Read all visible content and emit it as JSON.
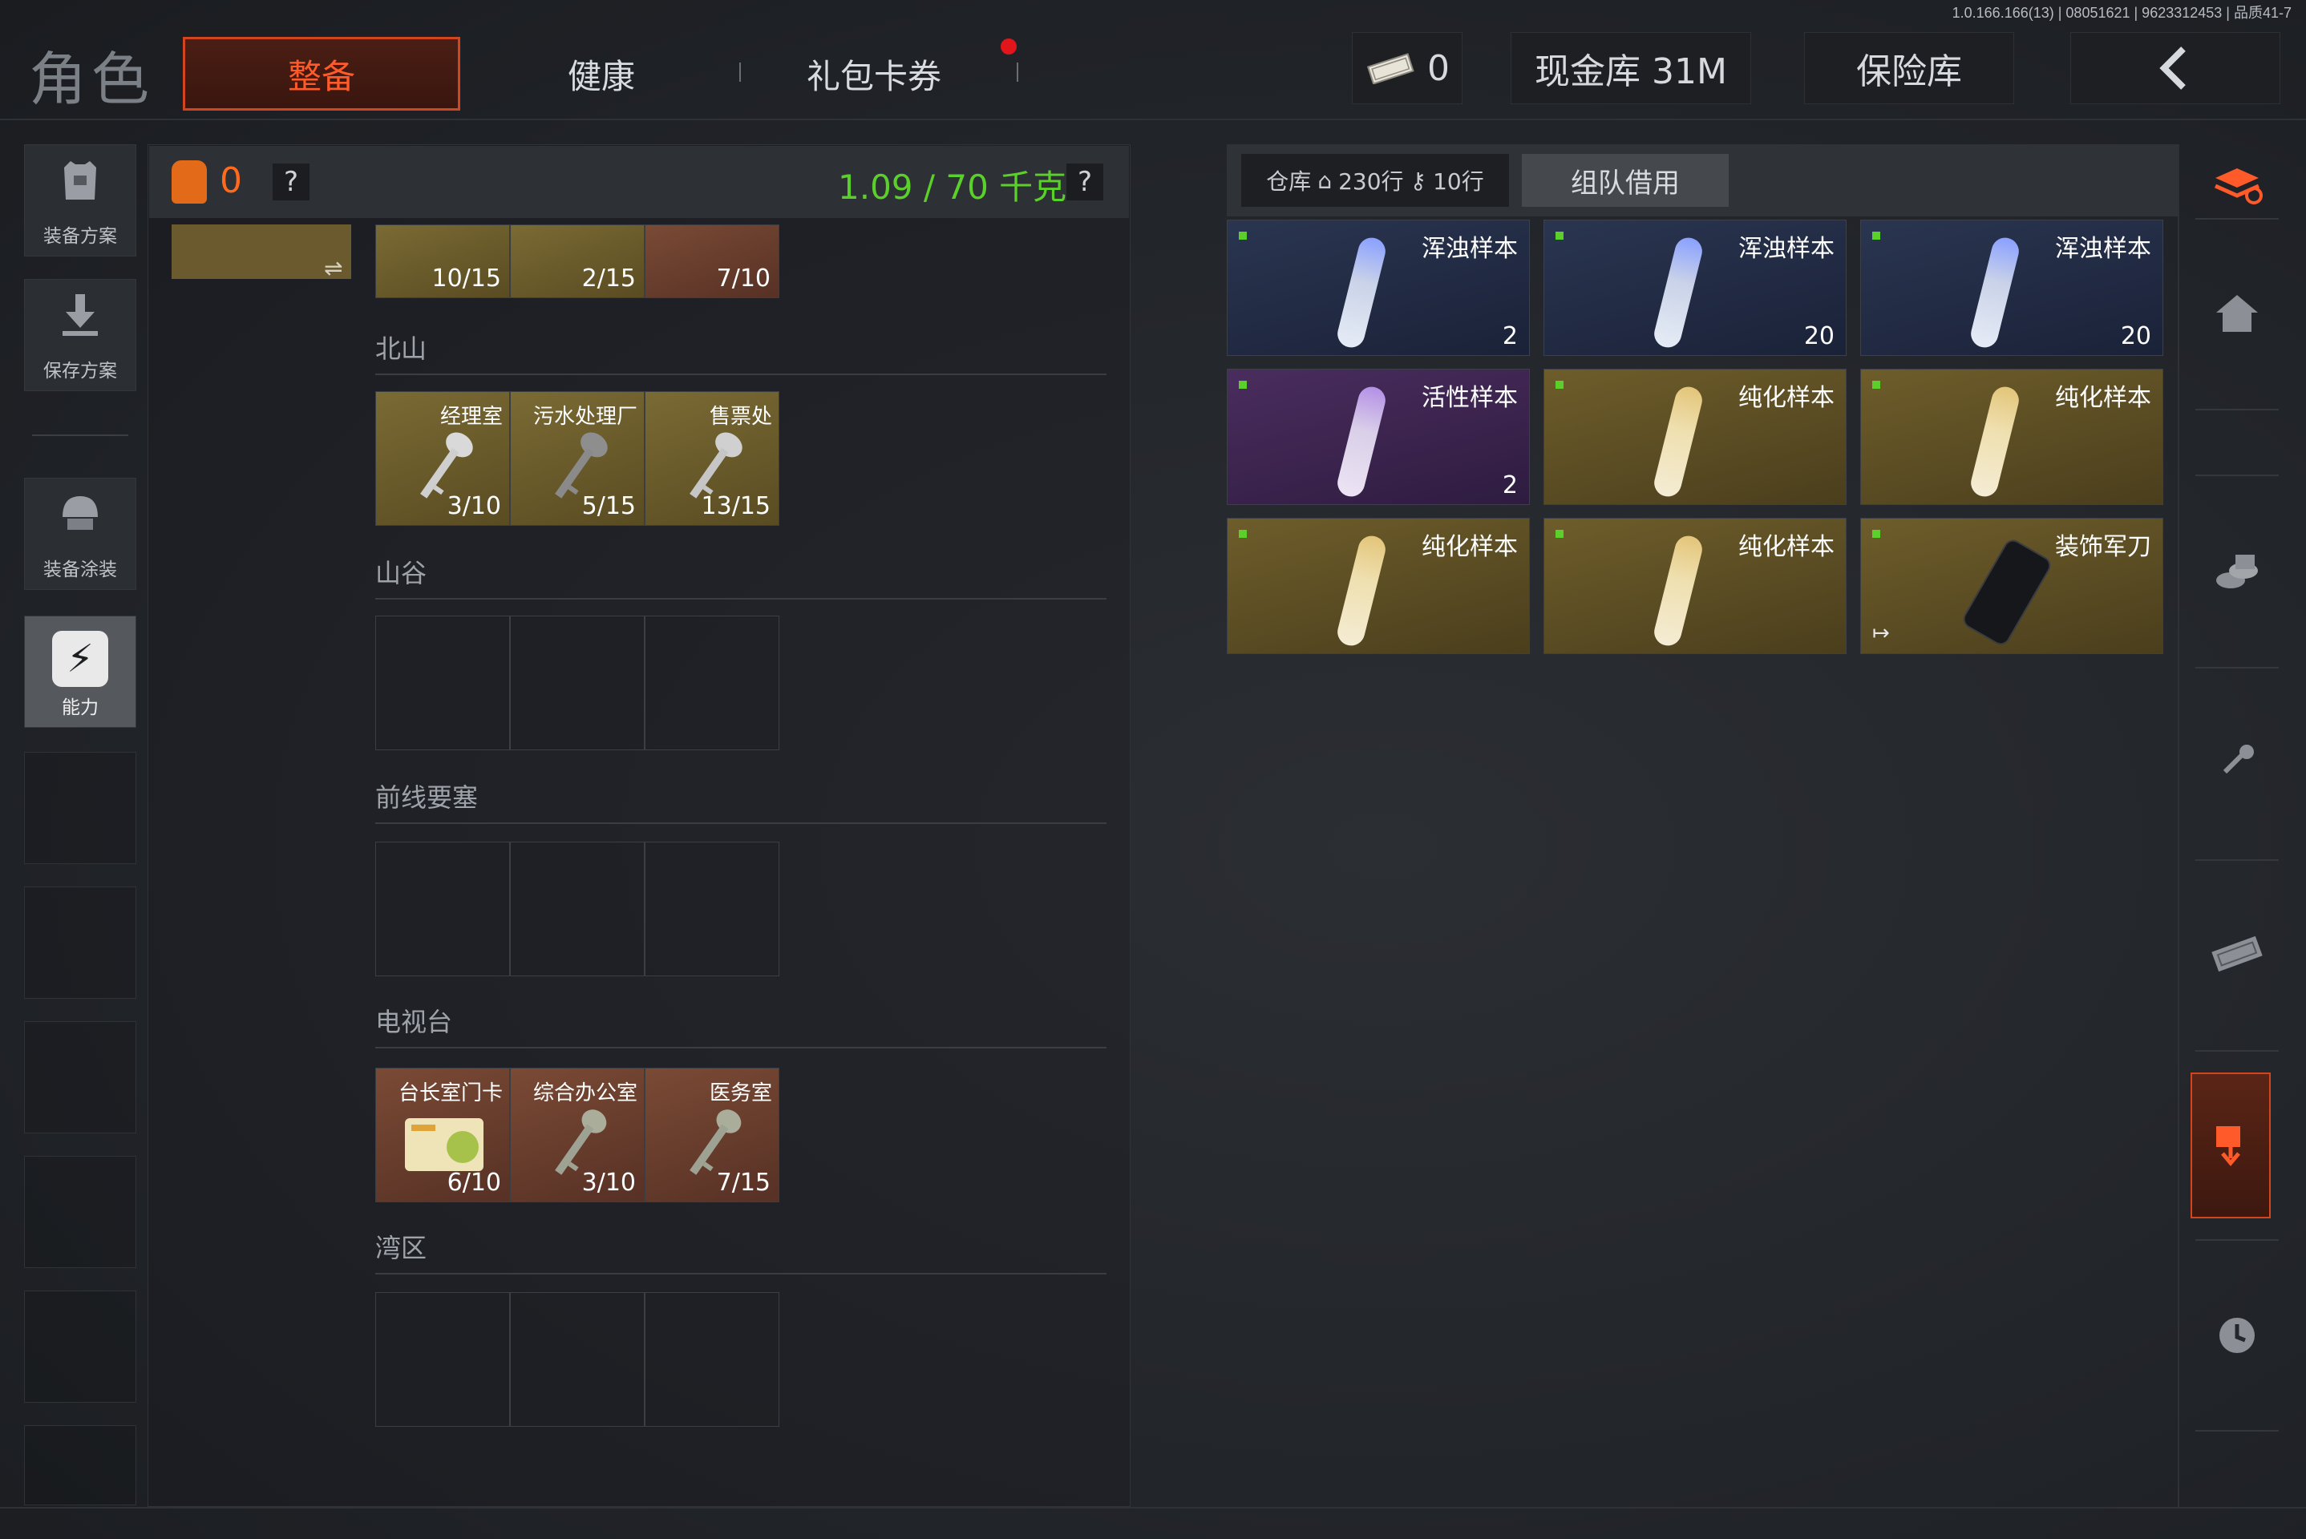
{
  "version": "1.0.166.166(13) | 08051621 | 9623312453 | 品质41-7",
  "header": {
    "title": "角色",
    "tabs": [
      {
        "label": "整备",
        "active": true
      },
      {
        "label": "健康",
        "active": false
      },
      {
        "label": "礼包卡券",
        "active": false,
        "has_notification": true
      }
    ],
    "cash_amount": "0",
    "cash_vault_label": "现金库 31M",
    "safe_label": "保险库",
    "back_icon": "chevron-left-icon"
  },
  "sidebar": {
    "items": [
      {
        "label": "装备方案",
        "icon": "vest-icon"
      },
      {
        "label": "保存方案",
        "icon": "download-icon"
      },
      {
        "label": "装备涂装",
        "icon": "helmet-icon"
      },
      {
        "label": "能力",
        "icon": "lightning-icon",
        "active": true
      }
    ]
  },
  "inventory": {
    "backpack_count": "0",
    "weight_text": "1.09 / 70 千克",
    "help": "?",
    "swap_icon": "⇌",
    "top_keys": [
      {
        "count": "10/15"
      },
      {
        "count": "2/15"
      },
      {
        "count": "7/10"
      }
    ],
    "categories": [
      {
        "name": "北山",
        "slots": [
          {
            "name": "经理室",
            "count": "3/10",
            "style": "gold"
          },
          {
            "name": "污水处理厂",
            "count": "5/15",
            "style": "gold"
          },
          {
            "name": "售票处",
            "count": "13/15",
            "style": "gold"
          }
        ]
      },
      {
        "name": "山谷",
        "slots": []
      },
      {
        "name": "前线要塞",
        "slots": []
      },
      {
        "name": "电视台",
        "slots": [
          {
            "name": "台长室门卡",
            "count": "6/10",
            "style": "red"
          },
          {
            "name": "综合办公室",
            "count": "3/10",
            "style": "red"
          },
          {
            "name": "医务室",
            "count": "7/15",
            "style": "red"
          }
        ]
      },
      {
        "name": "湾区",
        "slots": []
      }
    ]
  },
  "warehouse": {
    "label": "仓库",
    "rows_home": "230行",
    "rows_key": "10行",
    "team_borrow_label": "组队借用",
    "items": [
      {
        "name": "浑浊样本",
        "count": "2",
        "rarity": "blue"
      },
      {
        "name": "浑浊样本",
        "count": "20",
        "rarity": "blue"
      },
      {
        "name": "浑浊样本",
        "count": "20",
        "rarity": "blue"
      },
      {
        "name": "活性样本",
        "count": "2",
        "rarity": "purple"
      },
      {
        "name": "纯化样本",
        "count": "",
        "rarity": "gold"
      },
      {
        "name": "纯化样本",
        "count": "",
        "rarity": "gold"
      },
      {
        "name": "纯化样本",
        "count": "",
        "rarity": "gold"
      },
      {
        "name": "纯化样本",
        "count": "",
        "rarity": "gold"
      },
      {
        "name": "装饰军刀",
        "count": "",
        "rarity": "gold"
      }
    ]
  },
  "right_sidebar": {
    "icons": [
      "stack-icon",
      "home-icon",
      "coins-icon",
      "key-icon",
      "cash-icon",
      "deposit-icon",
      "clock-icon"
    ]
  },
  "colors": {
    "accent": "#ff5a2a",
    "weight_green": "#5bd02a",
    "rarity_blue": "#2a3550",
    "rarity_purple": "#4a2d5e",
    "rarity_gold": "#6e5d2b"
  }
}
